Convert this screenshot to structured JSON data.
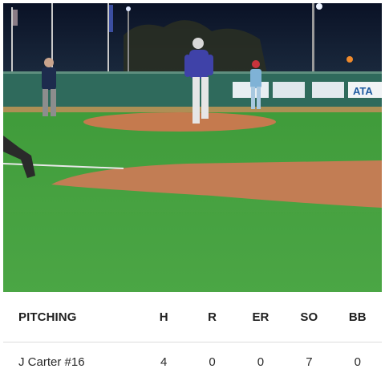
{
  "video": {
    "banner_text": "ATA"
  },
  "pitching": {
    "headers": {
      "name": "PITCHING",
      "h": "H",
      "r": "R",
      "er": "ER",
      "so": "SO",
      "bb": "BB"
    },
    "rows": [
      {
        "name": "J Carter #16",
        "h": "4",
        "r": "0",
        "er": "0",
        "so": "7",
        "bb": "0"
      }
    ]
  }
}
